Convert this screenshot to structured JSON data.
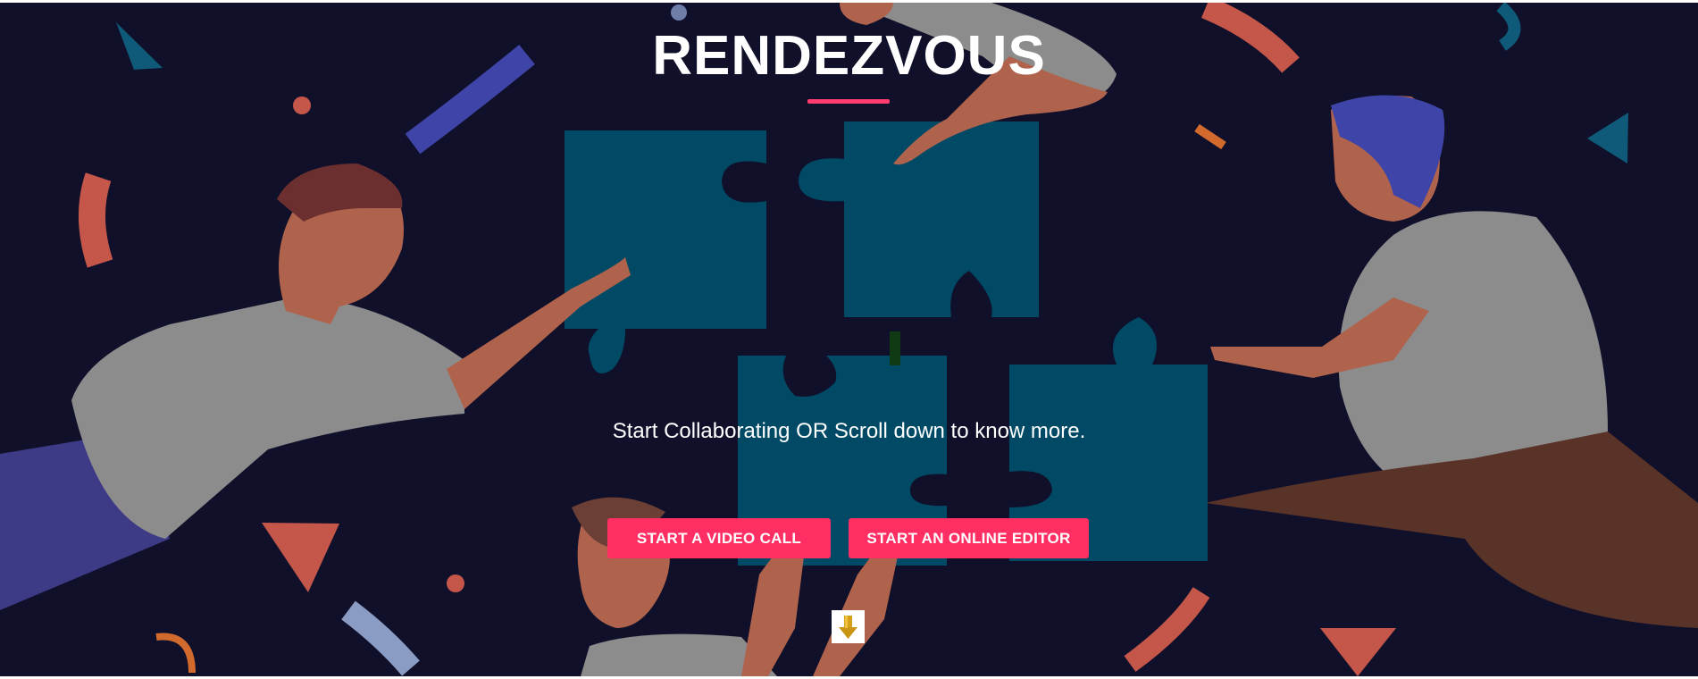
{
  "hero": {
    "title": "RENDEZVOUS",
    "tagline": "Start Collaborating OR Scroll down to know more.",
    "buttons": {
      "video_call": "START A VIDEO CALL",
      "online_editor": "START AN ONLINE EDITOR"
    },
    "scroll_icon": "down-arrow-icon"
  },
  "colors": {
    "background": "#11102a",
    "accent": "#ff2e63",
    "puzzle": "#004a66",
    "shirt": "#8c8c8c",
    "skin": "#b0634c"
  }
}
